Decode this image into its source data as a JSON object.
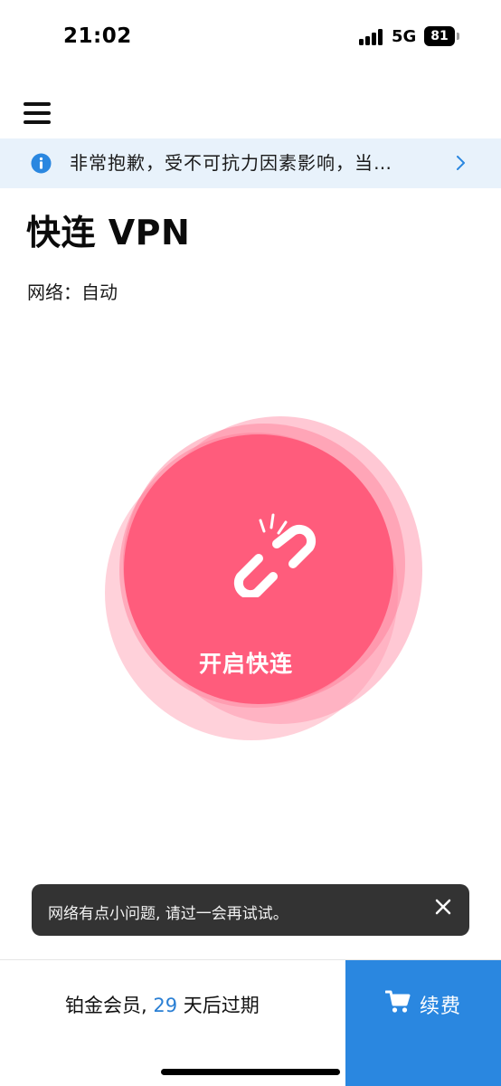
{
  "status_bar": {
    "time": "21:02",
    "network_type": "5G",
    "battery_level": "81"
  },
  "notice": {
    "icon": "info-icon",
    "text": "非常抱歉，受不可抗力因素影响，当…"
  },
  "header": {
    "title": "快连 VPN",
    "network_label": "网络：",
    "network_value": "自动"
  },
  "connect": {
    "icon": "broken-link-icon",
    "label": "开启快连",
    "accent_color": "#ff5c7c"
  },
  "toast": {
    "message": "网络有点小问题, 请过一会再试试。"
  },
  "bottom_bar": {
    "membership_prefix": "铂金会员, ",
    "days_remaining": "29",
    "membership_suffix": " 天后过期",
    "renew_label": "续费",
    "renew_color": "#2a87e0"
  }
}
